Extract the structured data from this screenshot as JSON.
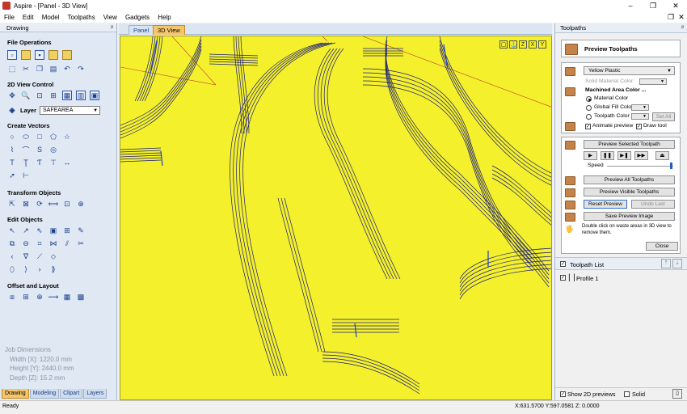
{
  "window": {
    "title": "Aspire - [Panel - 3D View]",
    "minimize": "–",
    "maximize": "❐",
    "close": "✕"
  },
  "menu": {
    "items": [
      "File",
      "Edit",
      "Model",
      "Toolpaths",
      "View",
      "Gadgets",
      "Help"
    ],
    "restore": "❐",
    "close": "✕"
  },
  "left_panel": {
    "header": "Drawing",
    "pin": "ᵖ",
    "sections": {
      "file_operations": "File Operations",
      "view_control": "2D View Control",
      "create_vectors": "Create Vectors",
      "transform_objects": "Transform Objects",
      "edit_objects": "Edit Objects",
      "offset_layout": "Offset and Layout"
    },
    "layer_label": "Layer",
    "layer_value": "SAFEAREA",
    "job_dimensions": {
      "title": "Job Dimensions",
      "width": "Width  [X]: 1220.0 mm",
      "height": "Height [Y]: 2440.0 mm",
      "depth": "Depth  [Z]: 15.2 mm"
    },
    "tabs": [
      "Drawing",
      "Modeling",
      "Clipart",
      "Layers"
    ]
  },
  "doc_tabs": [
    "Panel",
    "3D View"
  ],
  "view": {
    "tools": [
      "▢",
      "⚓",
      "Z",
      "X",
      "Y"
    ]
  },
  "right_panel": {
    "header": "Toolpaths",
    "pin": "ᵖ",
    "preview_title": "Preview Toolpaths",
    "material": "Yellow Plastic",
    "solid_material_color": "Solid Material Color",
    "machined_area_color": "Machined Area Color ...",
    "opt_material_color": "Material Color",
    "opt_global_fill": "Global Fill Color",
    "opt_toolpath_color": "Toolpath Color",
    "set_all": "Set All",
    "animate_preview": "Animate preview",
    "draw_tool": "Draw tool",
    "preview_selected": "Preview Selected Toolpath",
    "speed_label": "Speed",
    "preview_all": "Preview All Toolpaths",
    "preview_visible": "Preview Visible Toolpaths",
    "reset_preview": "Reset Preview",
    "undo_last": "Undo Last",
    "save_preview": "Save Preview Image",
    "hint": "Double click on waste areas in 3D view to remove them.",
    "close": "Close",
    "toolpath_list": "Toolpath List",
    "profile": "Profile 1",
    "show_2d": "Show 2D previews",
    "solid": "Solid"
  },
  "status": {
    "left": "Ready",
    "coords": "X:631.5700 Y:597.0581 Z:  0.0000"
  },
  "colors": {
    "view_background": "#f4f12c",
    "toolpath_line": "#1a1a7a",
    "tab_active": "#f5c56b"
  }
}
